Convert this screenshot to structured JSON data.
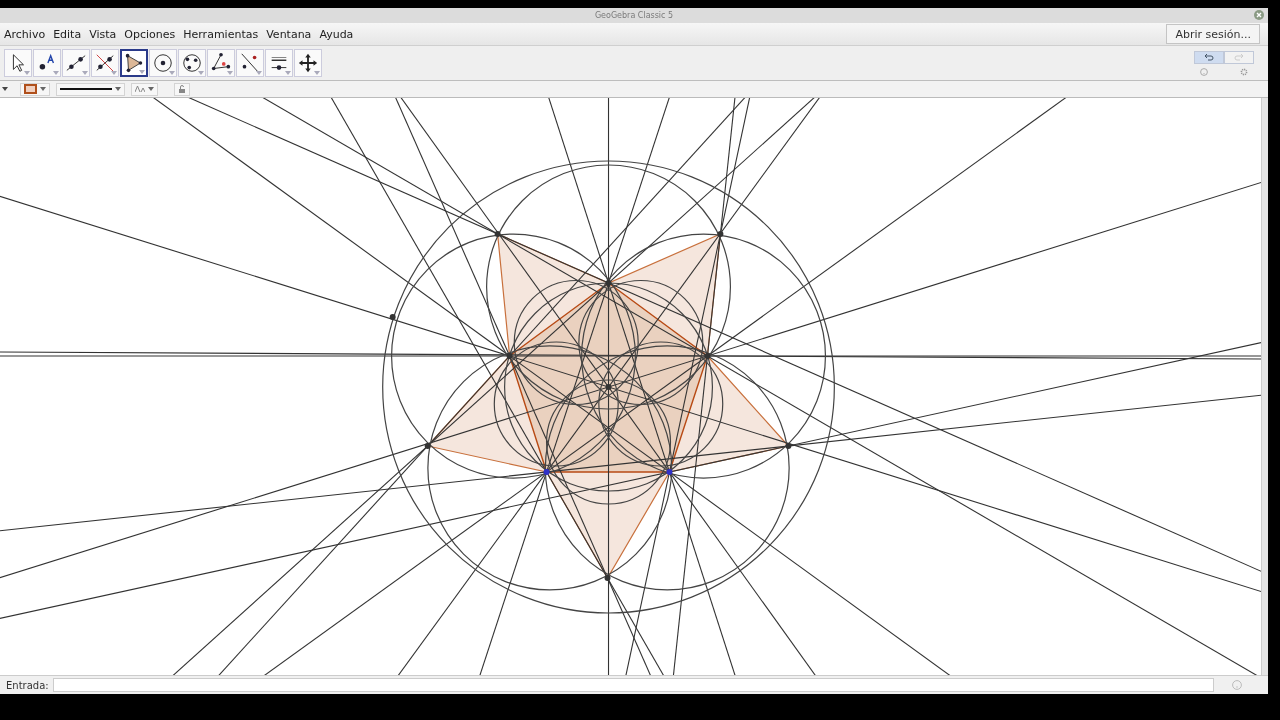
{
  "window": {
    "title": "GeoGebra Classic 5"
  },
  "menu": [
    "Archivo",
    "Edita",
    "Vista",
    "Opciones",
    "Herramientas",
    "Ventana",
    "Ayuda"
  ],
  "login_button": "Abrir sesión...",
  "tools": [
    {
      "kind": "move",
      "selected": false
    },
    {
      "kind": "point",
      "selected": false
    },
    {
      "kind": "line",
      "selected": false
    },
    {
      "kind": "perpendicular",
      "selected": false
    },
    {
      "kind": "polygon",
      "selected": true
    },
    {
      "kind": "circle",
      "selected": false
    },
    {
      "kind": "circle3",
      "selected": false
    },
    {
      "kind": "angle",
      "selected": false
    },
    {
      "kind": "reflect",
      "selected": false
    },
    {
      "kind": "slider",
      "selected": false
    },
    {
      "kind": "pan",
      "selected": false
    }
  ],
  "undo": {
    "disabled": false
  },
  "redo": {
    "disabled": true
  },
  "input_bar": {
    "label": "Entrada:"
  }
}
